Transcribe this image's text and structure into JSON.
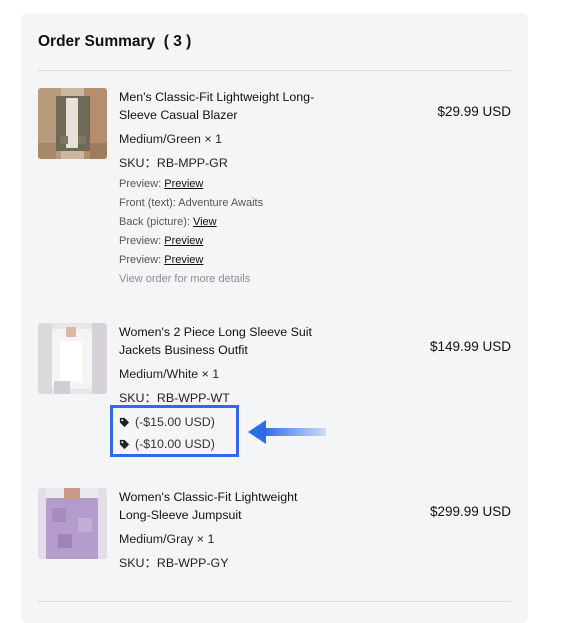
{
  "order_summary": {
    "title": "Order Summary  ( 3 )",
    "items": [
      {
        "name": "Men's Classic-Fit Lightweight Long-Sleeve Casual Blazer",
        "variant": "Medium/Green × 1",
        "sku": "SKU：RB-MPP-GR",
        "price": "$29.99 USD",
        "properties": [
          {
            "label": "Preview: ",
            "value": "Preview",
            "link": true
          },
          {
            "label": "Front (text): ",
            "value": "Adventure Awaits",
            "link": false
          },
          {
            "label": "Back (picture): ",
            "value": "View",
            "link": true
          },
          {
            "label": "Preview: ",
            "value": "Preview",
            "link": true
          },
          {
            "label": "Preview: ",
            "value": "Preview",
            "link": true
          }
        ],
        "more_details": "View order for more details"
      },
      {
        "name": "Women's 2 Piece Long Sleeve Suit Jackets Business Outfit",
        "variant": "Medium/White × 1",
        "sku": "SKU：RB-WPP-WT",
        "price": "$149.99 USD",
        "discounts": [
          "(-$15.00 USD)",
          "(-$10.00 USD)"
        ]
      },
      {
        "name": "Women's Classic-Fit Lightweight Long-Sleeve Jumpsuit",
        "variant": "Medium/Gray × 1",
        "sku": "SKU：RB-WPP-GY",
        "price": "$299.99 USD"
      }
    ]
  },
  "colors": {
    "highlight": "#2f6be8",
    "panel_bg": "#f4f5f7"
  },
  "icons": {
    "discount": "tag-icon",
    "annotation": "arrow-left-icon"
  }
}
